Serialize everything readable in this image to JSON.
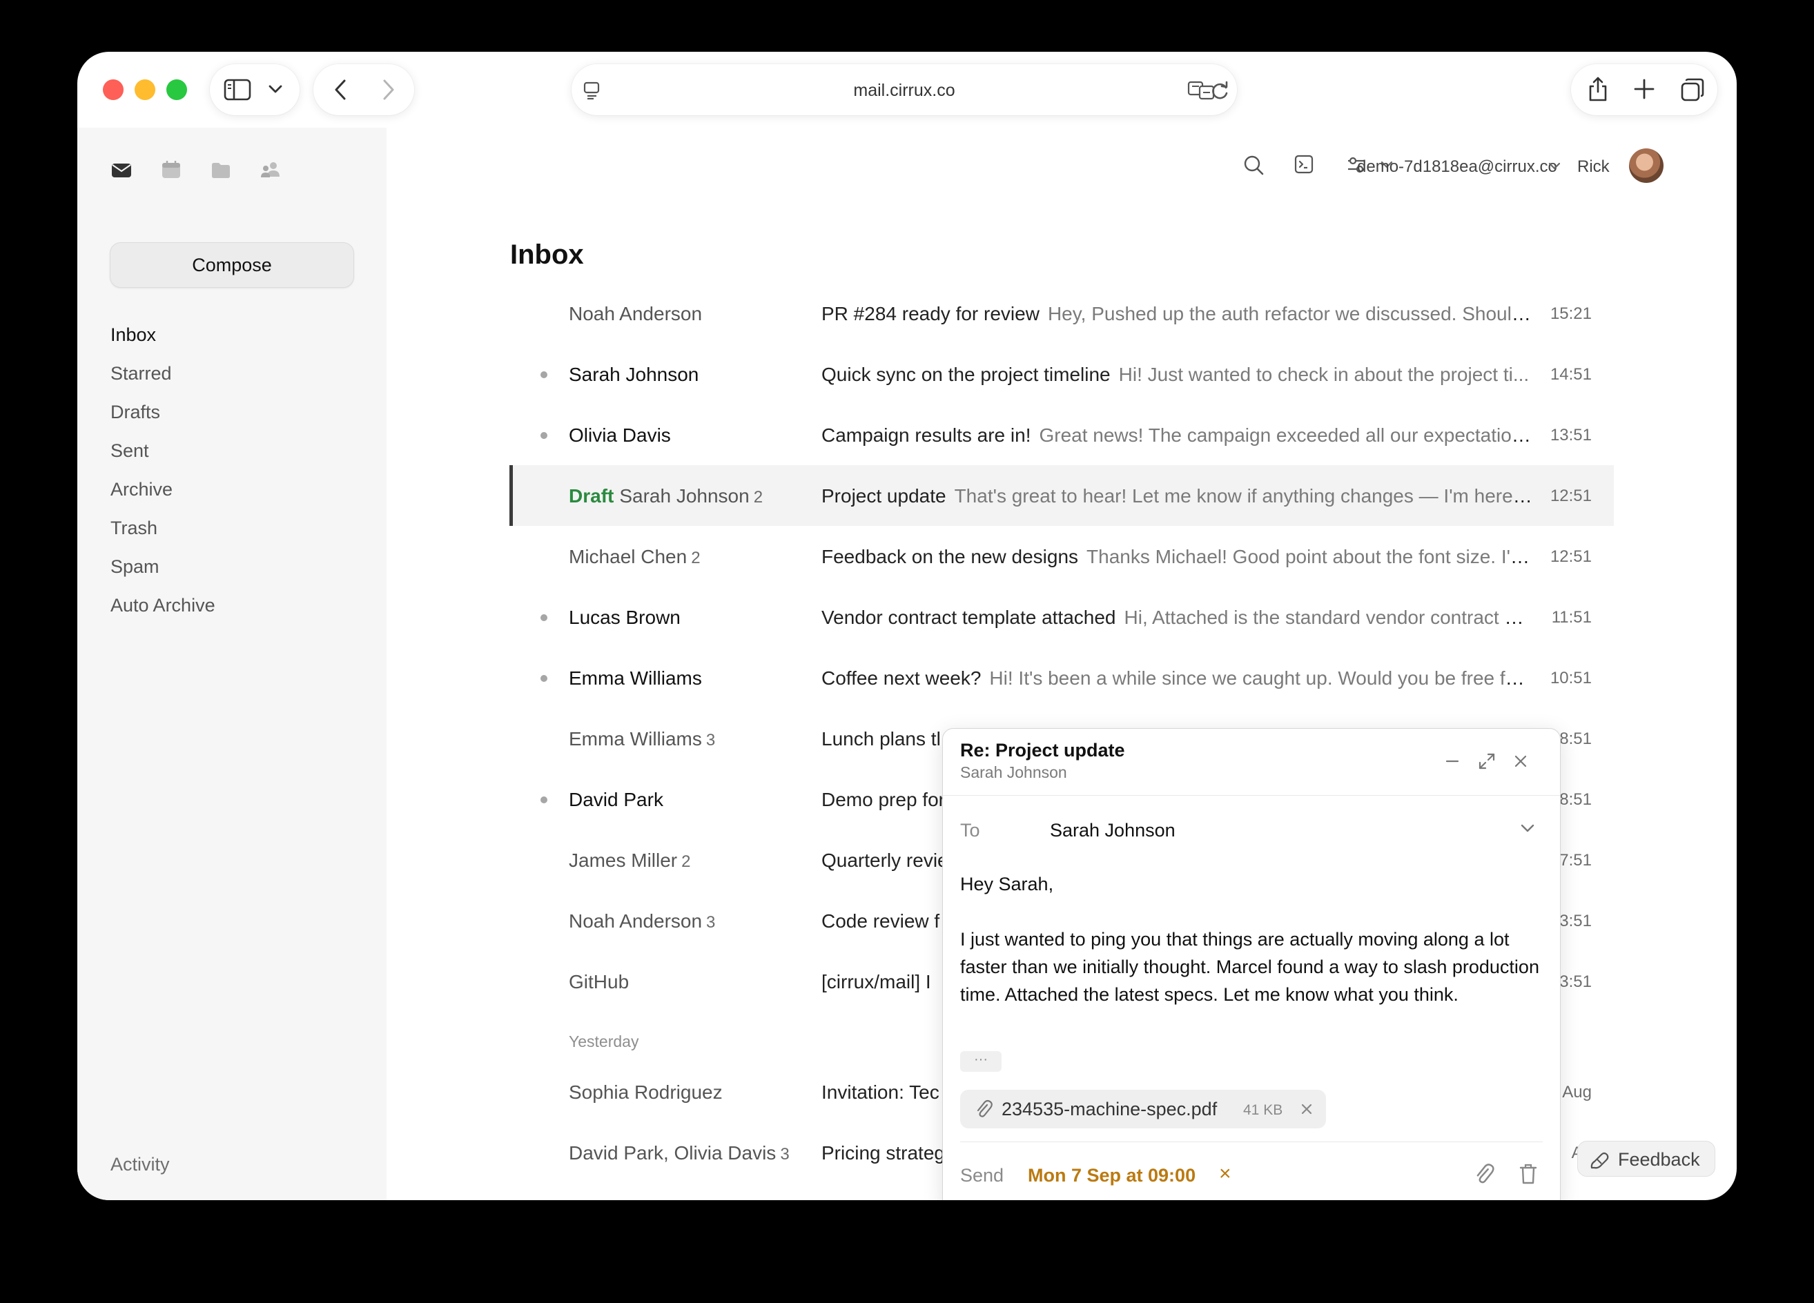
{
  "browser": {
    "url": "mail.cirrux.co"
  },
  "app": {
    "compose_label": "Compose",
    "folders": [
      {
        "label": "Inbox",
        "active": true
      },
      {
        "label": "Starred"
      },
      {
        "label": "Drafts"
      },
      {
        "label": "Sent"
      },
      {
        "label": "Archive"
      },
      {
        "label": "Trash"
      },
      {
        "label": "Spam"
      },
      {
        "label": "Auto Archive"
      }
    ],
    "activity_label": "Activity",
    "account_email": "demo-7d1818ea@cirrux.co",
    "user_name": "Rick",
    "page_title": "Inbox"
  },
  "emails": [
    {
      "sender": "Noah Anderson",
      "count": "",
      "unread": false,
      "subject": "PR #284 ready for review",
      "preview": "Hey, Pushed up the auth refactor we discussed. Should ...",
      "time": "15:21"
    },
    {
      "sender": "Sarah Johnson",
      "count": "",
      "unread": true,
      "subject": "Quick sync on the project timeline",
      "preview": "Hi! Just wanted to check in about the project ti...",
      "time": "14:51"
    },
    {
      "sender": "Olivia Davis",
      "count": "",
      "unread": true,
      "subject": "Campaign results are in!",
      "preview": "Great news! The campaign exceeded all our expectations:...",
      "time": "13:51"
    },
    {
      "sender": "Sarah Johnson",
      "draft": "Draft",
      "count": "2",
      "unread": false,
      "selected": true,
      "subject": "Project update",
      "preview": "That's great to hear! Let me know if anything changes — I'm here if ...",
      "time": "12:51"
    },
    {
      "sender": "Michael Chen",
      "count": "2",
      "unread": false,
      "subject": "Feedback on the new designs",
      "preview": "Thanks Michael! Good point about the font size. I'll ...",
      "time": "12:51"
    },
    {
      "sender": "Lucas Brown",
      "count": "",
      "unread": true,
      "subject": "Vendor contract template attached",
      "preview": "Hi, Attached is the standard vendor contract w...",
      "time": "11:51"
    },
    {
      "sender": "Emma Williams",
      "count": "",
      "unread": true,
      "subject": "Coffee next week?",
      "preview": "Hi! It's been a while since we caught up. Would you be free for ...",
      "time": "10:51"
    },
    {
      "sender": "Emma Williams",
      "count": "3",
      "unread": false,
      "subject": "Lunch plans tl",
      "preview": "",
      "time": "8:51"
    },
    {
      "sender": "David Park",
      "count": "",
      "unread": true,
      "subject": "Demo prep for",
      "preview": "",
      "time": "8:51"
    },
    {
      "sender": "James Miller",
      "count": "2",
      "unread": false,
      "subject": "Quarterly revie",
      "preview": "",
      "time": "7:51"
    },
    {
      "sender": "Noah Anderson",
      "count": "3",
      "unread": false,
      "subject": "Code review f",
      "preview": "",
      "time": "3:51"
    },
    {
      "sender": "GitHub",
      "count": "",
      "unread": false,
      "subject": "[cirrux/mail] I",
      "preview": "",
      "time": "3:51"
    }
  ],
  "group_label": "Yesterday",
  "emails_yesterday": [
    {
      "sender": "Sophia Rodriguez",
      "count": "",
      "unread": false,
      "subject": "Invitation: Tec",
      "preview": "",
      "time": "Aug"
    },
    {
      "sender": "David Park, Olivia Davis",
      "count": "3",
      "unread": false,
      "subject": "Pricing strateg",
      "preview": "",
      "time": "Au"
    }
  ],
  "composer": {
    "title": "Re: Project update",
    "subtitle": "Sarah Johnson",
    "to_label": "To",
    "to_value": "Sarah Johnson",
    "greeting": "Hey Sarah,",
    "body": "I just wanted to ping you that things are actually moving along a lot faster than we initially thought. Marcel found a way to slash production time. Attached the latest specs. Let me know what you think.",
    "ellipsis": "···",
    "attachment_name": "234535-machine-spec.pdf",
    "attachment_size": "41 KB",
    "send_label": "Send",
    "schedule": "Mon 7 Sep at 09:00",
    "schedule_clear": "×"
  },
  "feedback_label": "Feedback",
  "colors": {
    "draft": "#2a8a3f",
    "schedule": "#bb7a10",
    "traffic_red": "#fe5f57",
    "traffic_yellow": "#febc2e",
    "traffic_green": "#28c840"
  }
}
